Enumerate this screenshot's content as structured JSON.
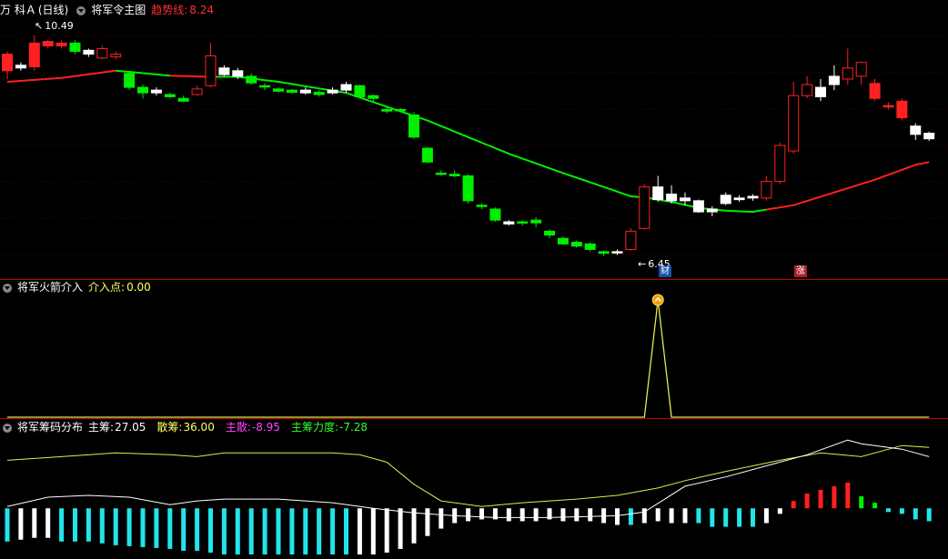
{
  "header": {
    "stock": "万 科Ａ",
    "period": "(日线)",
    "indicator": "将军令主图",
    "trend_label": "趋势线:",
    "trend_value": "8.24"
  },
  "panel2": {
    "title": "将军火箭介入",
    "label": "介入点:",
    "value": "0.00"
  },
  "panel3": {
    "title": "将军筹码分布",
    "items": [
      {
        "label": "主筹:",
        "value": "27.05",
        "color": "#ffffff"
      },
      {
        "label": "散筹:",
        "value": "36.00",
        "color": "#ffff66"
      },
      {
        "label": "主散:",
        "value": "-8.95",
        "color": "#ff44ff"
      },
      {
        "label": "主筹力度:",
        "value": "-7.28",
        "color": "#33ff33"
      }
    ]
  },
  "colors": {
    "up": "#ff2020",
    "down": "#00ee00",
    "flat": "#ffffff",
    "cyan": "#22e5ea",
    "yellow": "#e8e84a",
    "divider": "#c00000"
  },
  "annotations": {
    "high": "10.49",
    "low": "6.45",
    "badge_cai": "财",
    "badge_zhang": "涨"
  },
  "chart_data": [
    {
      "type": "candlestick",
      "title": "将军令主图",
      "ylim": [
        6.2,
        10.8
      ],
      "candles": [
        [
          10.15,
          9.85,
          10.2,
          9.7,
          "up"
        ],
        [
          9.9,
          9.95,
          10.0,
          9.85,
          "flat"
        ],
        [
          10.35,
          9.92,
          10.49,
          9.85,
          "up"
        ],
        [
          10.38,
          10.3,
          10.4,
          10.25,
          "up"
        ],
        [
          10.35,
          10.3,
          10.4,
          10.25,
          "up"
        ],
        [
          10.2,
          10.35,
          10.4,
          10.15,
          "down"
        ],
        [
          10.15,
          10.22,
          10.25,
          10.1,
          "flat"
        ],
        [
          10.08,
          10.25,
          10.3,
          10.05,
          "up"
        ],
        [
          10.1,
          10.15,
          10.2,
          10.05,
          "up"
        ],
        [
          9.8,
          9.55,
          9.85,
          9.5,
          "down"
        ],
        [
          9.45,
          9.55,
          9.6,
          9.35,
          "down"
        ],
        [
          9.5,
          9.45,
          9.55,
          9.4,
          "flat"
        ],
        [
          9.42,
          9.38,
          9.45,
          9.35,
          "down"
        ],
        [
          9.35,
          9.3,
          9.4,
          9.28,
          "down"
        ],
        [
          9.42,
          9.52,
          9.58,
          9.4,
          "up"
        ],
        [
          9.58,
          10.12,
          10.35,
          9.55,
          "up"
        ],
        [
          9.9,
          9.78,
          9.95,
          9.75,
          "flat"
        ],
        [
          9.85,
          9.75,
          9.9,
          9.7,
          "flat"
        ],
        [
          9.75,
          9.63,
          9.8,
          9.6,
          "down"
        ],
        [
          9.58,
          9.58,
          9.62,
          9.5,
          "down"
        ],
        [
          9.52,
          9.48,
          9.55,
          9.45,
          "down"
        ],
        [
          9.5,
          9.46,
          9.52,
          9.43,
          "down"
        ],
        [
          9.45,
          9.5,
          9.55,
          9.42,
          "flat"
        ],
        [
          9.42,
          9.46,
          9.5,
          9.38,
          "down"
        ],
        [
          9.45,
          9.5,
          9.55,
          9.42,
          "flat"
        ],
        [
          9.6,
          9.5,
          9.65,
          9.45,
          "flat"
        ],
        [
          9.58,
          9.38,
          9.6,
          9.35,
          "down"
        ],
        [
          9.4,
          9.35,
          9.42,
          9.3,
          "down"
        ],
        [
          9.15,
          9.12,
          9.2,
          9.08,
          "down"
        ],
        [
          9.15,
          9.13,
          9.18,
          9.1,
          "down"
        ],
        [
          9.05,
          8.65,
          9.1,
          8.62,
          "down"
        ],
        [
          8.45,
          8.2,
          8.48,
          8.18,
          "down"
        ],
        [
          8.0,
          8.0,
          8.05,
          7.95,
          "down"
        ],
        [
          7.98,
          7.95,
          8.05,
          7.92,
          "down"
        ],
        [
          7.95,
          7.5,
          7.98,
          7.45,
          "down"
        ],
        [
          7.42,
          7.4,
          7.45,
          7.35,
          "down"
        ],
        [
          7.35,
          7.15,
          7.38,
          7.12,
          "down"
        ],
        [
          7.12,
          7.08,
          7.15,
          7.05,
          "flat"
        ],
        [
          7.1,
          7.12,
          7.15,
          7.05,
          "down"
        ],
        [
          7.1,
          7.15,
          7.2,
          7.02,
          "down"
        ],
        [
          6.95,
          6.88,
          6.98,
          6.82,
          "down"
        ],
        [
          6.82,
          6.72,
          6.85,
          6.7,
          "down"
        ],
        [
          6.75,
          6.68,
          6.78,
          6.65,
          "down"
        ],
        [
          6.72,
          6.62,
          6.75,
          6.58,
          "down"
        ],
        [
          6.58,
          6.55,
          6.6,
          6.5,
          "down"
        ],
        [
          6.58,
          6.58,
          6.62,
          6.52,
          "flat"
        ],
        [
          6.62,
          6.95,
          7.0,
          6.6,
          "up"
        ],
        [
          7.0,
          7.75,
          7.8,
          6.98,
          "up"
        ],
        [
          7.75,
          7.52,
          7.95,
          7.48,
          "flat"
        ],
        [
          7.62,
          7.5,
          7.78,
          7.45,
          "flat"
        ],
        [
          7.5,
          7.55,
          7.65,
          7.42,
          "flat"
        ],
        [
          7.5,
          7.3,
          7.52,
          7.28,
          "flat"
        ],
        [
          7.35,
          7.3,
          7.4,
          7.22,
          "flat"
        ],
        [
          7.45,
          7.6,
          7.65,
          7.42,
          "flat"
        ],
        [
          7.55,
          7.52,
          7.6,
          7.48,
          "flat"
        ],
        [
          7.55,
          7.58,
          7.62,
          7.5,
          "flat"
        ],
        [
          7.55,
          7.85,
          7.95,
          7.5,
          "up"
        ],
        [
          7.85,
          8.5,
          8.55,
          7.8,
          "up"
        ],
        [
          8.4,
          9.4,
          9.65,
          8.35,
          "up"
        ],
        [
          9.4,
          9.6,
          9.75,
          9.35,
          "up"
        ],
        [
          9.55,
          9.38,
          9.7,
          9.3,
          "flat"
        ],
        [
          9.6,
          9.75,
          9.95,
          9.5,
          "flat"
        ],
        [
          9.7,
          9.9,
          10.25,
          9.6,
          "up"
        ],
        [
          9.75,
          10.0,
          10.0,
          9.6,
          "up"
        ],
        [
          9.62,
          9.35,
          9.7,
          9.3,
          "up"
        ],
        [
          9.22,
          9.2,
          9.28,
          9.15,
          "up"
        ],
        [
          9.3,
          9.0,
          9.35,
          8.95,
          "up"
        ],
        [
          8.85,
          8.7,
          8.9,
          8.6,
          "flat"
        ],
        [
          8.72,
          8.62,
          8.75,
          8.58,
          "flat"
        ]
      ],
      "trend_line": [
        [
          0,
          9.65
        ],
        [
          4,
          9.72
        ],
        [
          8,
          9.85
        ],
        [
          9,
          9.83
        ],
        [
          12,
          9.76
        ],
        [
          15,
          9.74
        ],
        [
          17,
          9.74
        ],
        [
          20,
          9.65
        ],
        [
          25,
          9.45
        ],
        [
          28,
          9.2
        ],
        [
          31,
          8.95
        ],
        [
          34,
          8.65
        ],
        [
          37,
          8.35
        ],
        [
          41,
          8.0
        ],
        [
          44,
          7.75
        ],
        [
          46,
          7.58
        ],
        [
          47,
          7.56
        ],
        [
          49,
          7.48
        ],
        [
          51,
          7.37
        ],
        [
          53,
          7.32
        ],
        [
          55,
          7.3
        ],
        [
          58,
          7.42
        ],
        [
          61,
          7.65
        ],
        [
          64,
          7.88
        ],
        [
          67,
          8.15
        ],
        [
          68,
          8.2
        ]
      ],
      "trend_color_segments": [
        [
          0,
          8,
          "up"
        ],
        [
          8,
          12,
          "down"
        ],
        [
          12,
          15,
          "up"
        ],
        [
          15,
          56,
          "down"
        ],
        [
          56,
          68,
          "up"
        ]
      ]
    },
    {
      "type": "line",
      "title": "将军火箭介入",
      "series": [
        {
          "name": "介入点",
          "values": [
            [
              0,
              0
            ],
            [
              47,
              0
            ],
            [
              48,
              10
            ],
            [
              49,
              0
            ],
            [
              68,
              0
            ]
          ]
        }
      ],
      "ylim": [
        0,
        10
      ]
    },
    {
      "type": "bar",
      "title": "将军筹码分布",
      "bars": [
        [
          -3.6,
          "cyan"
        ],
        [
          -3.4,
          "white"
        ],
        [
          -3.2,
          "white"
        ],
        [
          -3.2,
          "white"
        ],
        [
          -3.6,
          "cyan"
        ],
        [
          -3.6,
          "cyan"
        ],
        [
          -3.6,
          "cyan"
        ],
        [
          -3.8,
          "cyan"
        ],
        [
          -4.0,
          "cyan"
        ],
        [
          -4.1,
          "cyan"
        ],
        [
          -4.2,
          "cyan"
        ],
        [
          -4.3,
          "cyan"
        ],
        [
          -4.4,
          "cyan"
        ],
        [
          -4.6,
          "cyan"
        ],
        [
          -4.6,
          "cyan"
        ],
        [
          -4.8,
          "cyan"
        ],
        [
          -5.0,
          "cyan"
        ],
        [
          -5.0,
          "cyan"
        ],
        [
          -5.0,
          "cyan"
        ],
        [
          -5.0,
          "cyan"
        ],
        [
          -5.0,
          "cyan"
        ],
        [
          -5.0,
          "cyan"
        ],
        [
          -5.0,
          "cyan"
        ],
        [
          -5.0,
          "cyan"
        ],
        [
          -5.0,
          "cyan"
        ],
        [
          -5.0,
          "cyan"
        ],
        [
          -5.0,
          "white"
        ],
        [
          -5.0,
          "white"
        ],
        [
          -4.8,
          "white"
        ],
        [
          -4.4,
          "white"
        ],
        [
          -3.8,
          "white"
        ],
        [
          -3.0,
          "white"
        ],
        [
          -2.2,
          "white"
        ],
        [
          -1.6,
          "white"
        ],
        [
          -1.4,
          "white"
        ],
        [
          -1.2,
          "white"
        ],
        [
          -1.2,
          "white"
        ],
        [
          -1.4,
          "white"
        ],
        [
          -1.4,
          "white"
        ],
        [
          -1.4,
          "white"
        ],
        [
          -1.2,
          "white"
        ],
        [
          -1.4,
          "white"
        ],
        [
          -1.4,
          "white"
        ],
        [
          -1.4,
          "white"
        ],
        [
          -1.6,
          "white"
        ],
        [
          -1.8,
          "white"
        ],
        [
          -1.8,
          "cyan"
        ],
        [
          -1.6,
          "white"
        ],
        [
          -1.4,
          "white"
        ],
        [
          -1.6,
          "white"
        ],
        [
          -1.6,
          "white"
        ],
        [
          -1.6,
          "cyan"
        ],
        [
          -2.0,
          "cyan"
        ],
        [
          -2.0,
          "cyan"
        ],
        [
          -2.0,
          "cyan"
        ],
        [
          -2.0,
          "cyan"
        ],
        [
          -1.6,
          "white"
        ],
        [
          -0.6,
          "white"
        ],
        [
          0.8,
          "red"
        ],
        [
          1.6,
          "red"
        ],
        [
          2.0,
          "red"
        ],
        [
          2.4,
          "red"
        ],
        [
          2.8,
          "red"
        ],
        [
          1.3,
          "green"
        ],
        [
          0.6,
          "green"
        ],
        [
          -0.4,
          "cyan"
        ],
        [
          -0.6,
          "cyan"
        ],
        [
          -1.2,
          "cyan"
        ],
        [
          -1.4,
          "cyan"
        ]
      ],
      "series": [
        {
          "name": "散筹",
          "color": "yellow",
          "values": [
            [
              0,
              5.2
            ],
            [
              4,
              5.6
            ],
            [
              8,
              6.0
            ],
            [
              12,
              5.8
            ],
            [
              14,
              5.6
            ],
            [
              16,
              6.0
            ],
            [
              20,
              6.0
            ],
            [
              24,
              6.0
            ],
            [
              26,
              5.8
            ],
            [
              28,
              5.0
            ],
            [
              30,
              2.6
            ],
            [
              32,
              0.8
            ],
            [
              35,
              0.2
            ],
            [
              38,
              0.6
            ],
            [
              42,
              1.0
            ],
            [
              45,
              1.4
            ],
            [
              48,
              2.2
            ],
            [
              50,
              3.0
            ],
            [
              53,
              4.0
            ],
            [
              57,
              5.2
            ],
            [
              60,
              6.0
            ],
            [
              63,
              5.6
            ],
            [
              66,
              6.8
            ],
            [
              68,
              6.6
            ]
          ]
        },
        {
          "name": "主筹",
          "color": "white",
          "values": [
            [
              0,
              0.2
            ],
            [
              3,
              1.2
            ],
            [
              6,
              1.4
            ],
            [
              9,
              1.2
            ],
            [
              12,
              0.4
            ],
            [
              14,
              0.8
            ],
            [
              16,
              1.0
            ],
            [
              20,
              1.0
            ],
            [
              24,
              0.6
            ],
            [
              27,
              0.0
            ],
            [
              30,
              -0.5
            ],
            [
              33,
              -0.8
            ],
            [
              36,
              -1.0
            ],
            [
              40,
              -1.0
            ],
            [
              45,
              -0.8
            ],
            [
              47,
              -0.4
            ],
            [
              50,
              2.4
            ],
            [
              53,
              3.4
            ],
            [
              56,
              4.6
            ],
            [
              59,
              5.8
            ],
            [
              62,
              7.4
            ],
            [
              63,
              7.0
            ],
            [
              66,
              6.4
            ],
            [
              68,
              5.6
            ]
          ]
        }
      ],
      "ylim": [
        -5,
        8
      ]
    }
  ]
}
